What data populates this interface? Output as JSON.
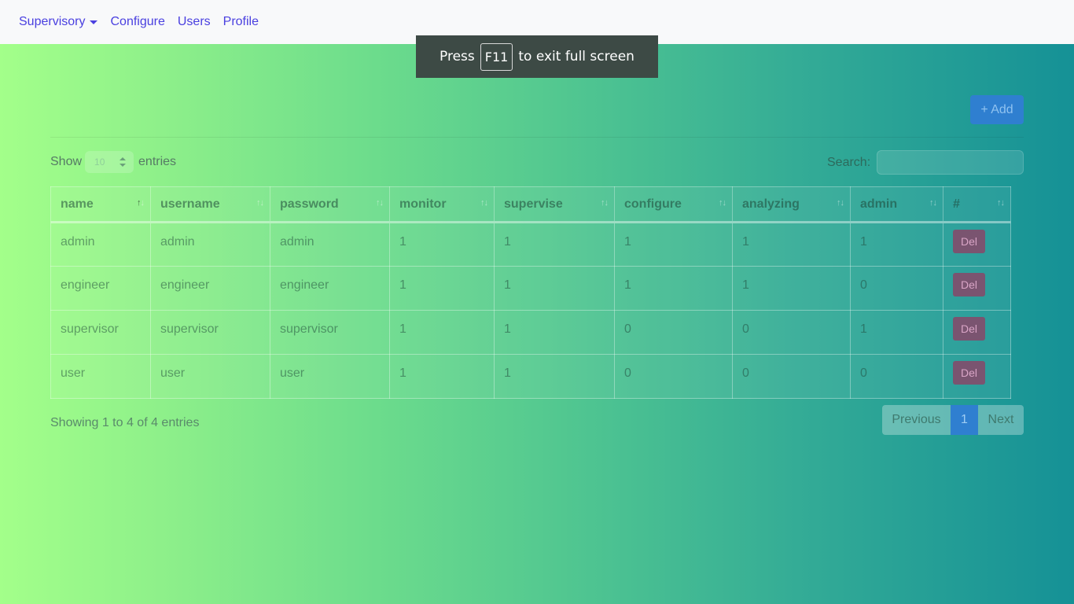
{
  "nav": {
    "items": [
      {
        "label": "Supervisory",
        "dropdown": true
      },
      {
        "label": "Configure"
      },
      {
        "label": "Users"
      },
      {
        "label": "Profile"
      }
    ]
  },
  "fullscreen_notice": {
    "prefix": "Press",
    "key": "F11",
    "suffix": "to exit full screen"
  },
  "add_button": {
    "label": "+ Add"
  },
  "length_control": {
    "show": "Show",
    "value": "10",
    "entries": "entries"
  },
  "search": {
    "label": "Search:",
    "placeholder": ""
  },
  "table": {
    "columns": [
      "name",
      "username",
      "password",
      "monitor",
      "supervise",
      "configure",
      "analyzing",
      "admin",
      "#"
    ],
    "rows": [
      {
        "cells": [
          "admin",
          "admin",
          "admin",
          "1",
          "1",
          "1",
          "1",
          "1"
        ],
        "action": "Del"
      },
      {
        "cells": [
          "engineer",
          "engineer",
          "engineer",
          "1",
          "1",
          "1",
          "1",
          "0"
        ],
        "action": "Del"
      },
      {
        "cells": [
          "supervisor",
          "supervisor",
          "supervisor",
          "1",
          "1",
          "0",
          "0",
          "1"
        ],
        "action": "Del"
      },
      {
        "cells": [
          "user",
          "user",
          "user",
          "1",
          "1",
          "0",
          "0",
          "0"
        ],
        "action": "Del"
      }
    ]
  },
  "info": "Showing 1 to 4 of 4 entries",
  "pagination": {
    "previous": "Previous",
    "current": "1",
    "next": "Next"
  }
}
